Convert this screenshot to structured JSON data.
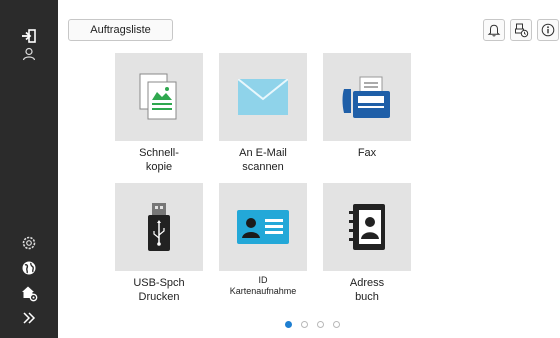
{
  "toolbar": {
    "job_list_label": "Auftragsliste"
  },
  "sidebar": {
    "icons": [
      "logout-icon",
      "user-icon",
      "settings-gear-icon",
      "globe-icon",
      "home-settings-icon",
      "expand-chevrons-icon"
    ]
  },
  "topright": {
    "icons": [
      "bell-icon",
      "job-status-icon",
      "info-icon"
    ]
  },
  "tiles": [
    {
      "line1": "Schnell-",
      "line2": "kopie",
      "icon": "copy-documents-icon"
    },
    {
      "line1": "An E-Mail",
      "line2": "scannen",
      "icon": "envelope-icon"
    },
    {
      "line1": "Fax",
      "line2": "",
      "icon": "fax-machine-icon"
    },
    {
      "line1": "USB-Spch",
      "line2": "Drucken",
      "icon": "usb-stick-icon"
    },
    {
      "line1": "ID",
      "line2": "Kartenaufnahme",
      "icon": "id-card-icon"
    },
    {
      "line1": "Adress",
      "line2": "buch",
      "icon": "address-book-icon"
    }
  ],
  "pager": {
    "page_count": 4,
    "active_page": 1
  },
  "colors": {
    "sidebar": "#2b2b2b",
    "tile_bg": "#e3e3e3",
    "accent_blue": "#1f7fd1",
    "green": "#2fa84f",
    "light_blue": "#8fd3ea"
  }
}
